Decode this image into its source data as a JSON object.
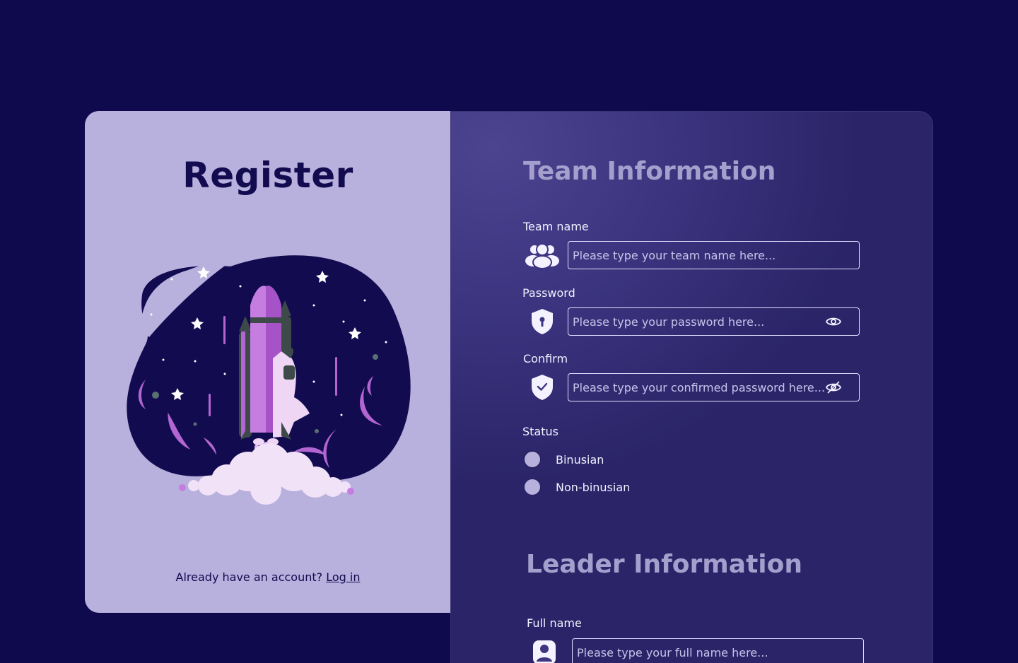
{
  "left": {
    "title": "Register",
    "login_prompt": "Already have an account?",
    "login_link": "Log in"
  },
  "team": {
    "title": "Team Information",
    "team_name": {
      "label": "Team name",
      "placeholder": "Please type your team name here...",
      "icon": "users-icon"
    },
    "password": {
      "label": "Password",
      "placeholder": "Please type your password here...",
      "icon": "shield-key-icon",
      "toggle_icon": "eye-icon"
    },
    "confirm": {
      "label": "Confirm",
      "placeholder": "Please type your confirmed password here...",
      "icon": "shield-check-icon",
      "toggle_icon": "eye-slash-icon"
    },
    "status": {
      "label": "Status",
      "options": [
        "Binusian",
        "Non-binusian"
      ]
    }
  },
  "leader": {
    "title": "Leader Information",
    "full_name": {
      "label": "Full name",
      "placeholder": "Please type your full name here...",
      "icon": "user-icon"
    }
  },
  "colors": {
    "background": "#0f0a4d",
    "left_panel": "#b8b0dd",
    "title_text": "#120b4f",
    "section_title": "#a49fcc"
  }
}
